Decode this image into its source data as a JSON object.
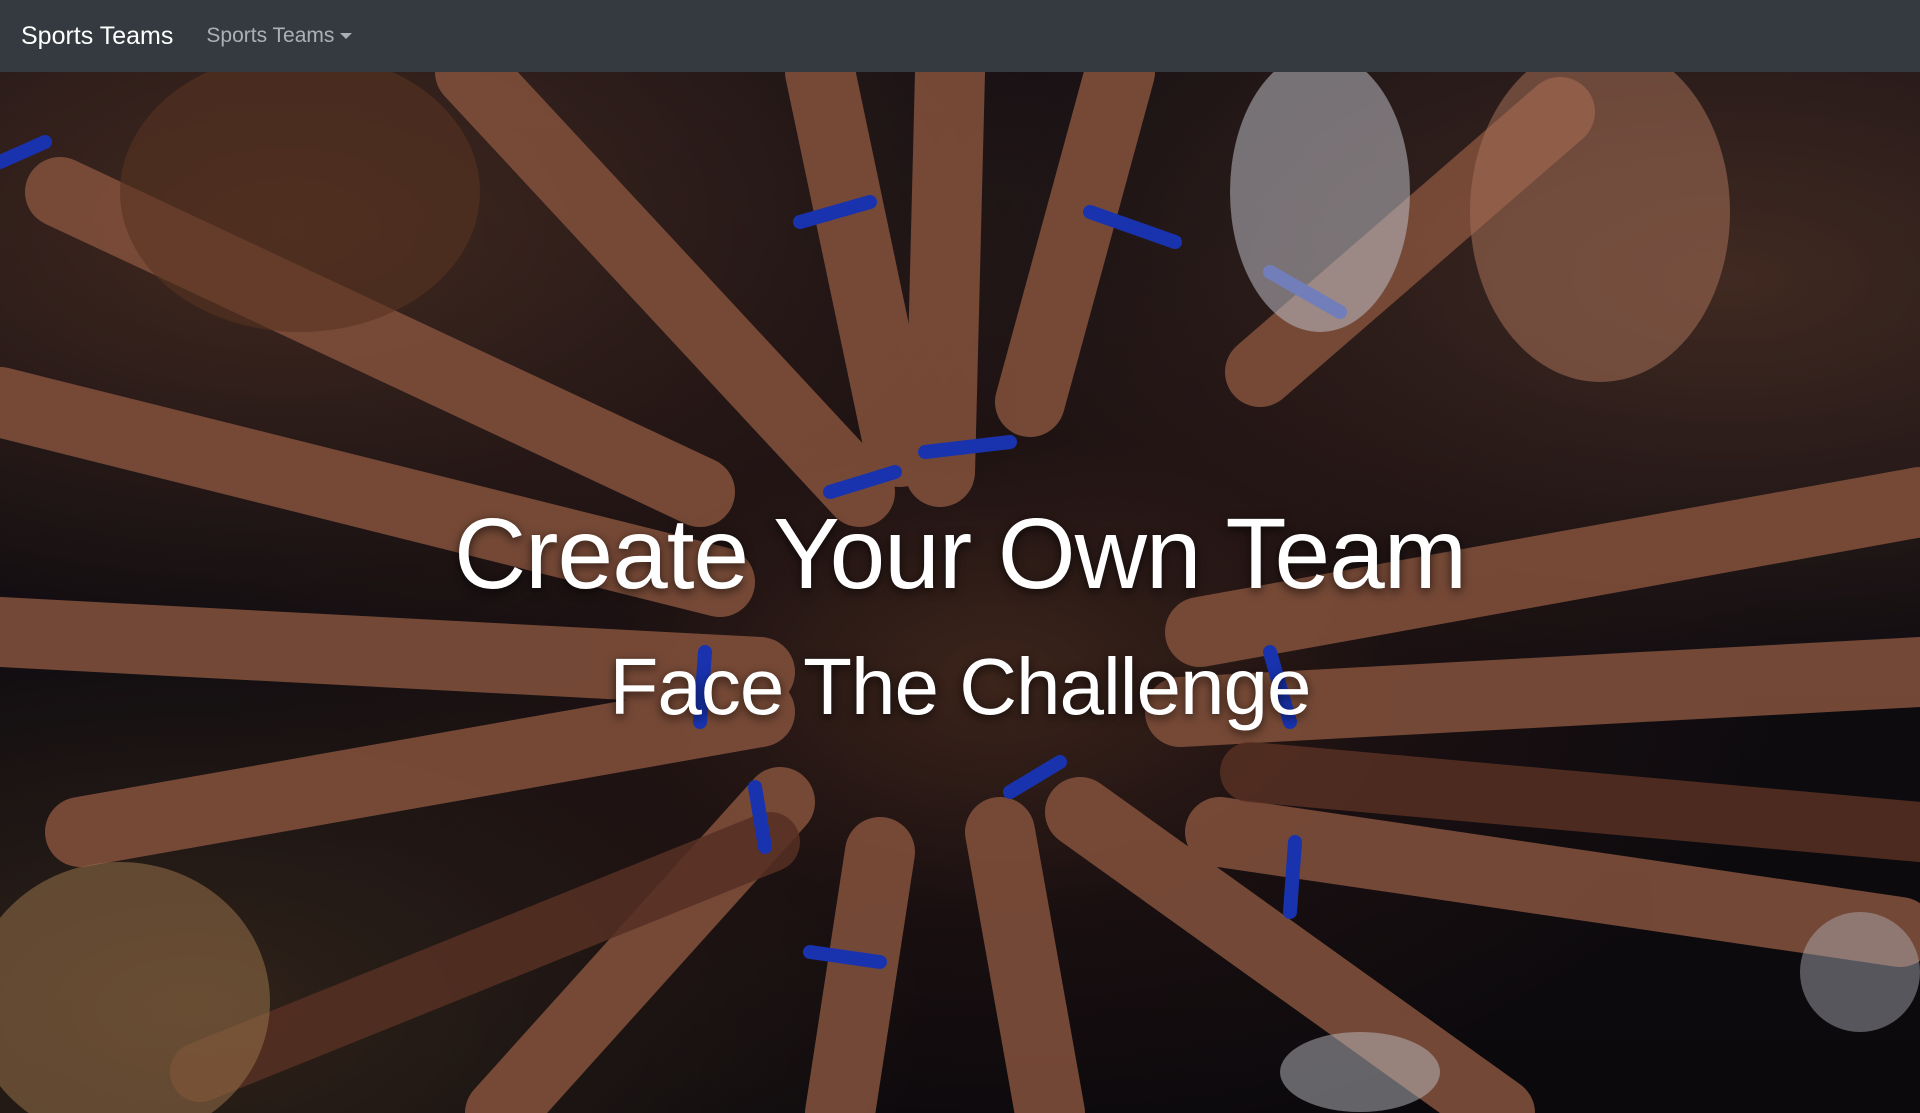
{
  "navbar": {
    "brand": "Sports Teams",
    "dropdown_label": "Sports Teams",
    "background": "#343a40"
  },
  "hero": {
    "title": "Create Your Own Team",
    "subtitle": "Face The Challenge",
    "image_alt": "Circle of many hands stacked together, wearing blue EMFASIS wristbands"
  },
  "icons": {
    "dropdown": "chevron-down-icon"
  },
  "colors": {
    "wristband": "#1f3fd6",
    "text": "#ffffff"
  }
}
